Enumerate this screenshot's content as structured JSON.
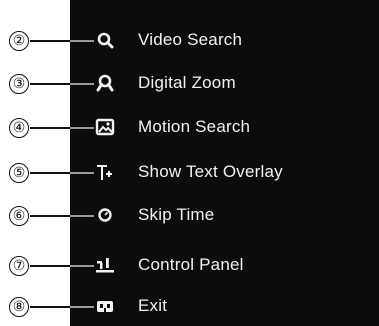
{
  "callouts": [
    "②",
    "③",
    "④",
    "⑤",
    "⑥",
    "⑦",
    "⑧"
  ],
  "menu": {
    "items": [
      {
        "label": "Video Search",
        "icon": "search-icon"
      },
      {
        "label": "Digital Zoom",
        "icon": "digital-zoom-icon"
      },
      {
        "label": "Motion Search",
        "icon": "motion-search-icon"
      },
      {
        "label": "Show Text Overlay",
        "icon": "text-overlay-icon"
      },
      {
        "label": "Skip Time",
        "icon": "skip-time-icon"
      },
      {
        "label": "Control Panel",
        "icon": "control-panel-icon"
      },
      {
        "label": "Exit",
        "icon": "exit-icon"
      }
    ]
  },
  "colors": {
    "panel_background": "#0c0c0c",
    "menu_text": "#f2f2f2",
    "callout": "#111111"
  }
}
